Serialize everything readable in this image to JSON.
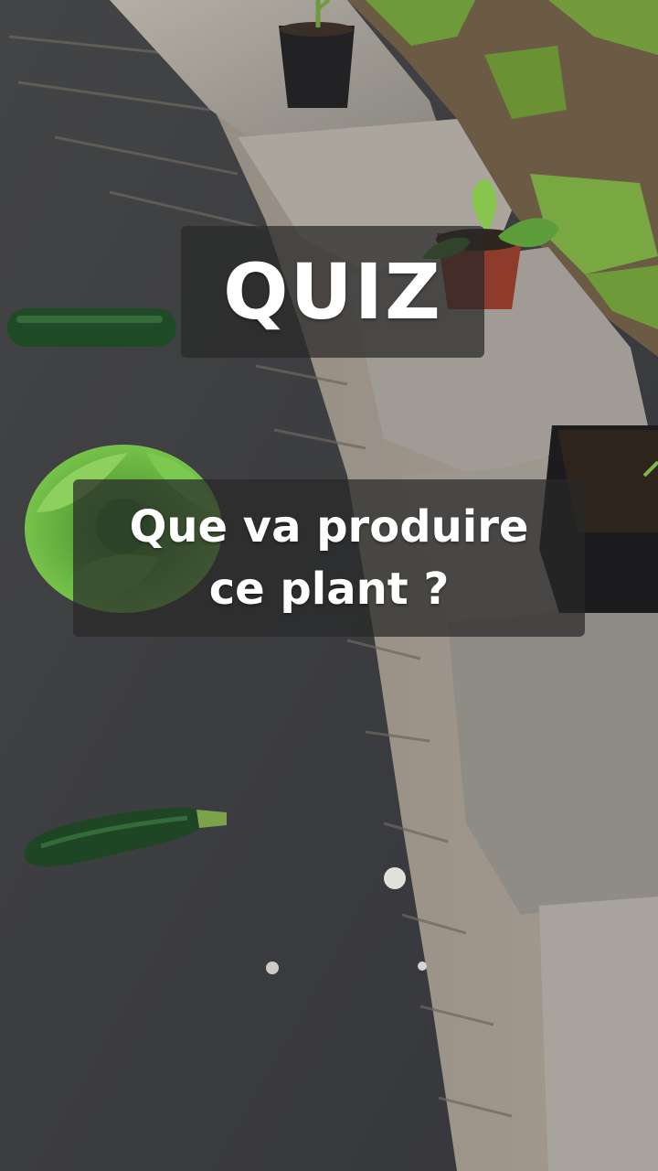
{
  "overlay": {
    "title": "QUIZ",
    "question_line_1": "Que va produire",
    "question_line_2": "ce plant ?"
  },
  "colors": {
    "asphalt": "#3d3e40",
    "stone_wall": "#9a9690",
    "soil": "#6b5a44",
    "grass": "#6f9a3a",
    "zucchini": "#1f4a26",
    "lettuce": "#5fae3c",
    "caption_background": "rgba(40,40,40,0.72)",
    "caption_text": "#ffffff"
  }
}
